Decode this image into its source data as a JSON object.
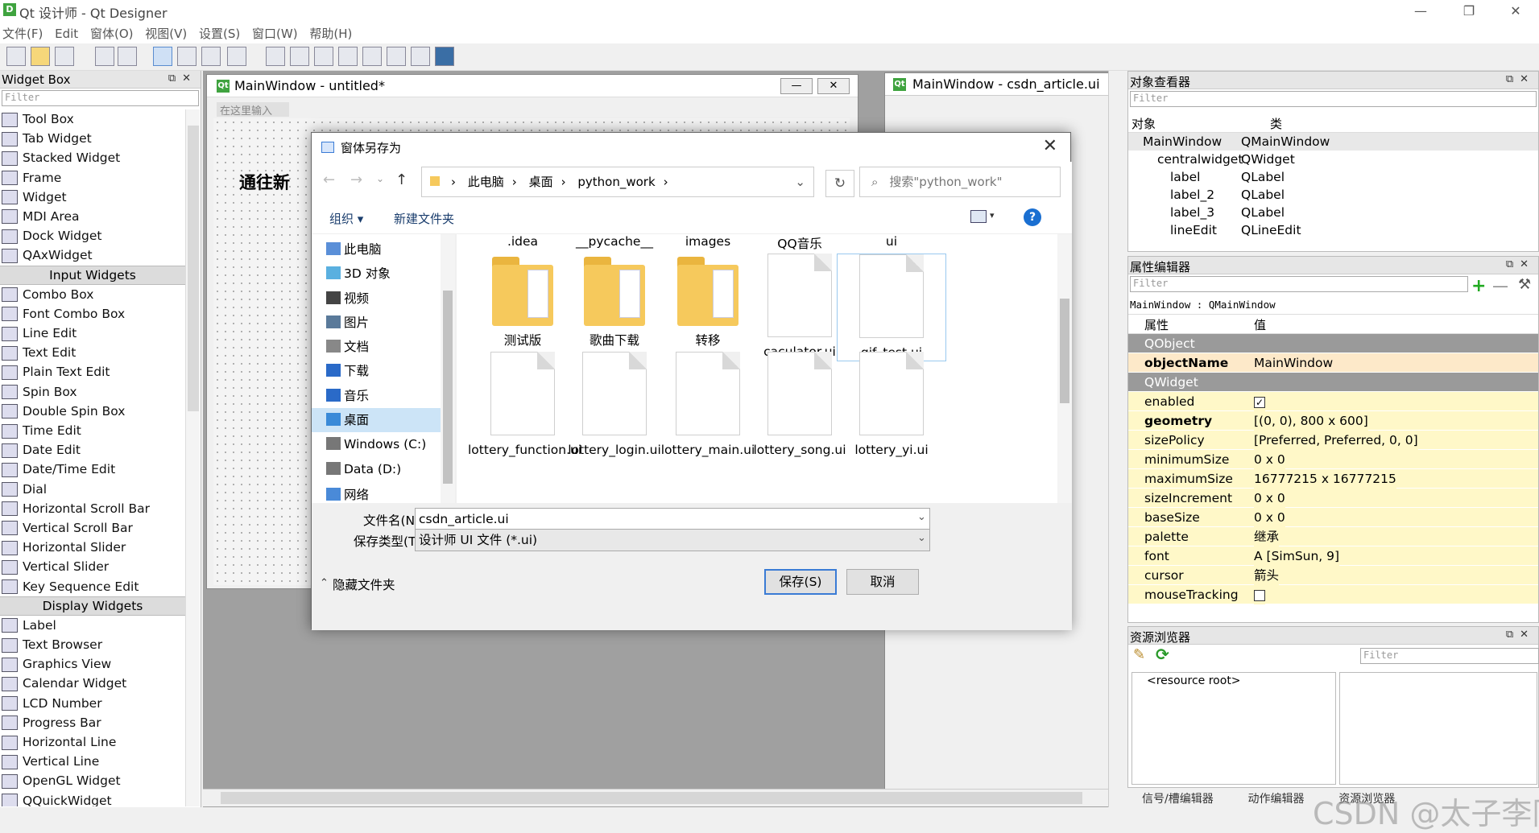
{
  "app": {
    "title": "Qt 设计师 - Qt Designer",
    "icon_label": "D"
  },
  "window_controls": {
    "minimize": "—",
    "restore": "❐",
    "close": "✕"
  },
  "menu": [
    "文件(F)",
    "Edit",
    "窗体(O)",
    "视图(V)",
    "设置(S)",
    "窗口(W)",
    "帮助(H)"
  ],
  "widget_box": {
    "title": "Widget Box",
    "filter_placeholder": "Filter",
    "rows": [
      {
        "label": "Tool Box"
      },
      {
        "label": "Tab Widget"
      },
      {
        "label": "Stacked Widget"
      },
      {
        "label": "Frame"
      },
      {
        "label": "Widget"
      },
      {
        "label": "MDI Area"
      },
      {
        "label": "Dock Widget"
      },
      {
        "label": "QAxWidget"
      },
      {
        "category": "Input Widgets"
      },
      {
        "label": "Combo Box"
      },
      {
        "label": "Font Combo Box"
      },
      {
        "label": "Line Edit"
      },
      {
        "label": "Text Edit"
      },
      {
        "label": "Plain Text Edit"
      },
      {
        "label": "Spin Box"
      },
      {
        "label": "Double Spin Box"
      },
      {
        "label": "Time Edit"
      },
      {
        "label": "Date Edit"
      },
      {
        "label": "Date/Time Edit"
      },
      {
        "label": "Dial"
      },
      {
        "label": "Horizontal Scroll Bar"
      },
      {
        "label": "Vertical Scroll Bar"
      },
      {
        "label": "Horizontal Slider"
      },
      {
        "label": "Vertical Slider"
      },
      {
        "label": "Key Sequence Edit"
      },
      {
        "category": "Display Widgets"
      },
      {
        "label": "Label"
      },
      {
        "label": "Text Browser"
      },
      {
        "label": "Graphics View"
      },
      {
        "label": "Calendar Widget"
      },
      {
        "label": "LCD Number"
      },
      {
        "label": "Progress Bar"
      },
      {
        "label": "Horizontal Line"
      },
      {
        "label": "Vertical Line"
      },
      {
        "label": "OpenGL Widget"
      },
      {
        "label": "QQuickWidget"
      }
    ]
  },
  "form_untitled": {
    "title": "MainWindow - untitled*",
    "type_here": "在这里输入",
    "label_text": "通往新",
    "min_btn": "—",
    "close_btn": "✕"
  },
  "form_article": {
    "title": "MainWindow - csdn_article.ui"
  },
  "object_inspector": {
    "title": "对象查看器",
    "filter_placeholder": "Filter",
    "col_object": "对象",
    "col_class": "类",
    "rows": [
      {
        "name": "MainWindow",
        "cls": "QMainWindow"
      },
      {
        "name": "centralwidget",
        "cls": "QWidget"
      },
      {
        "name": "label",
        "cls": "QLabel"
      },
      {
        "name": "label_2",
        "cls": "QLabel"
      },
      {
        "name": "label_3",
        "cls": "QLabel"
      },
      {
        "name": "lineEdit",
        "cls": "QLineEdit"
      }
    ]
  },
  "property_editor": {
    "title": "属性编辑器",
    "filter_placeholder": "Filter",
    "context": "MainWindow : QMainWindow",
    "col_prop": "属性",
    "col_value": "值",
    "group_qobject": "QObject",
    "group_qwidget": "QWidget",
    "object_name": {
      "key": "objectName",
      "value": "MainWindow"
    },
    "rows": [
      {
        "key": "enabled",
        "value": "✓"
      },
      {
        "key": "geometry",
        "value": "[(0, 0), 800 x 600]"
      },
      {
        "key": "sizePolicy",
        "value": "[Preferred, Preferred, 0, 0]"
      },
      {
        "key": "minimumSize",
        "value": "0 x 0"
      },
      {
        "key": "maximumSize",
        "value": "16777215 x 16777215"
      },
      {
        "key": "sizeIncrement",
        "value": "0 x 0"
      },
      {
        "key": "baseSize",
        "value": "0 x 0"
      },
      {
        "key": "palette",
        "value": "继承"
      },
      {
        "key": "font",
        "value": "A  [SimSun, 9]"
      },
      {
        "key": "cursor",
        "value": "箭头"
      },
      {
        "key": "mouseTracking",
        "value": ""
      }
    ]
  },
  "resource_browser": {
    "title": "资源浏览器",
    "filter_placeholder": "Filter",
    "root": "<resource root>"
  },
  "bottom_tabs": [
    "信号/槽编辑器",
    "动作编辑器",
    "资源浏览器"
  ],
  "dialog": {
    "title": "窗体另存为",
    "breadcrumb": [
      "此电脑",
      "桌面",
      "python_work"
    ],
    "search_placeholder": "搜索\"python_work\"",
    "organize": "组织 ▾",
    "new_folder": "新建文件夹",
    "nav": [
      {
        "label": "此电脑"
      },
      {
        "label": "3D 对象"
      },
      {
        "label": "视频"
      },
      {
        "label": "图片"
      },
      {
        "label": "文档"
      },
      {
        "label": "下载"
      },
      {
        "label": "音乐"
      },
      {
        "label": "桌面"
      },
      {
        "label": "Windows (C:)"
      },
      {
        "label": "Data (D:)"
      },
      {
        "label": "网络"
      }
    ],
    "top_names": [
      ".idea",
      "__pycache__",
      "images",
      "QQ音乐",
      "ui"
    ],
    "row1": [
      {
        "name": "测试版",
        "kind": "folder"
      },
      {
        "name": "歌曲下载",
        "kind": "folder"
      },
      {
        "name": "转移",
        "kind": "folder"
      },
      {
        "name": "caculator.ui",
        "kind": "file"
      },
      {
        "name": "gif_test.ui",
        "kind": "file"
      }
    ],
    "row2": [
      {
        "name": "lottery_function.ui",
        "kind": "file"
      },
      {
        "name": "lottery_login.ui",
        "kind": "file"
      },
      {
        "name": "lottery_main.ui",
        "kind": "file"
      },
      {
        "name": "lottery_song.ui",
        "kind": "file"
      },
      {
        "name": "lottery_yi.ui",
        "kind": "file"
      }
    ],
    "filename_label": "文件名(N):",
    "filename_value": "csdn_article.ui",
    "filetype_label": "保存类型(T):",
    "filetype_value": "设计师 UI 文件 (*.ui)",
    "hide_folders": "隐藏文件夹",
    "save": "保存(S)",
    "cancel": "取消"
  },
  "watermark": "CSDN @太子李同学"
}
